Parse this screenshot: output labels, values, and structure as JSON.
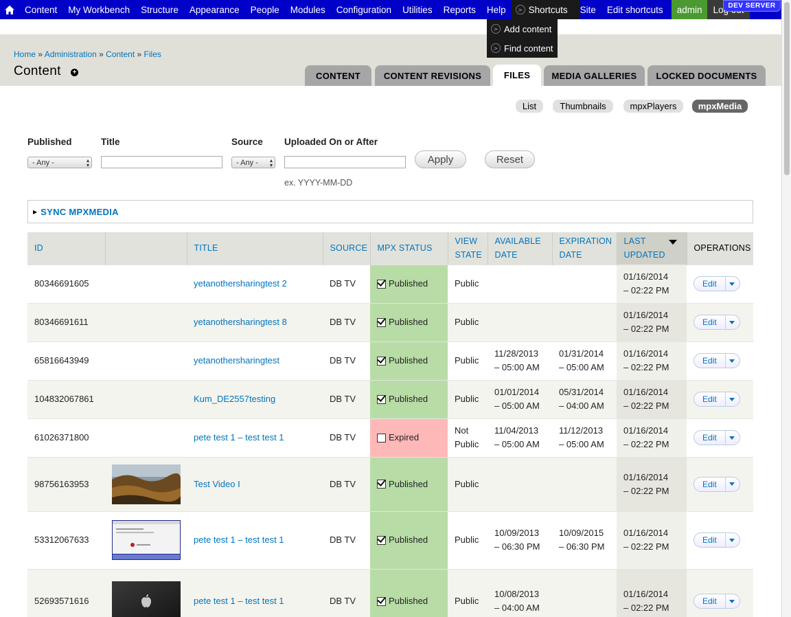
{
  "toolbar": {
    "items": [
      "Content",
      "My Workbench",
      "Structure",
      "Appearance",
      "People",
      "Modules",
      "Configuration",
      "Utilities",
      "Reports",
      "Help"
    ],
    "shortcuts_label": "Shortcuts",
    "site_label": "Site",
    "edit_shortcuts_label": "Edit shortcuts",
    "user_label": "admin",
    "logout_label": "Log out",
    "dev_badge": "DEV SERVER"
  },
  "shortcuts_menu": {
    "items": [
      "Add content",
      "Find content"
    ]
  },
  "breadcrumb": {
    "home": "Home",
    "administration": "Administration",
    "content": "Content",
    "files": "Files",
    "separator": "»"
  },
  "page": {
    "title": "Content",
    "add_shortcut_symbol": "+"
  },
  "tabs": [
    "CONTENT",
    "CONTENT REVISIONS",
    "FILES",
    "MEDIA GALLERIES",
    "LOCKED DOCUMENTS"
  ],
  "active_tab": "FILES",
  "secondary_tabs": [
    "List",
    "Thumbnails",
    "mpxPlayers",
    "mpxMedia"
  ],
  "active_secondary_tab": "mpxMedia",
  "filters": {
    "published_label": "Published",
    "published_value": "- Any -",
    "title_label": "Title",
    "title_value": "",
    "source_label": "Source",
    "source_value": "- Any -",
    "uploaded_label": "Uploaded On or After",
    "uploaded_value": "",
    "uploaded_hint": "ex. YYYY-MM-DD",
    "apply_label": "Apply",
    "reset_label": "Reset"
  },
  "sync_fieldset": {
    "label": "SYNC MPXMEDIA"
  },
  "table": {
    "headers": {
      "id": "ID",
      "title": "TITLE",
      "source": "SOURCE",
      "mpx_status": "MPX STATUS",
      "view_state_1": "VIEW",
      "view_state_2": "STATE",
      "available_1": "AVAILABLE",
      "available_2": "DATE",
      "expiration_1": "EXPIRATION",
      "expiration_2": "DATE",
      "last_updated_1": "LAST",
      "last_updated_2": "UPDATED",
      "operations": "OPERATIONS"
    },
    "sorted_column": "LAST UPDATED",
    "sort_direction": "descending",
    "edit_label": "Edit",
    "colors": {
      "published_bg": "#b8dca6",
      "expired_bg": "#ffb8b8"
    },
    "rows": [
      {
        "id": "80346691605",
        "thumbnail": "none",
        "title": "yetanothersharingtest 2",
        "source": "DB TV",
        "status": "Published",
        "checked": true,
        "view_state_1": "Public",
        "view_state_2": "",
        "avail_1": "",
        "avail_2": "",
        "exp_1": "",
        "exp_2": "",
        "updated_1": "01/16/2014",
        "updated_2": "– 02:22 PM"
      },
      {
        "id": "80346691611",
        "thumbnail": "none",
        "title": "yetanothersharingtest 8",
        "source": "DB TV",
        "status": "Published",
        "checked": true,
        "view_state_1": "Public",
        "view_state_2": "",
        "avail_1": "",
        "avail_2": "",
        "exp_1": "",
        "exp_2": "",
        "updated_1": "01/16/2014",
        "updated_2": "– 02:22 PM"
      },
      {
        "id": "65816643949",
        "thumbnail": "none",
        "title": "yetanothersharingtest",
        "source": "DB TV",
        "status": "Published",
        "checked": true,
        "view_state_1": "Public",
        "view_state_2": "",
        "avail_1": "11/28/2013",
        "avail_2": "– 05:00 AM",
        "exp_1": "01/31/2014",
        "exp_2": "– 05:00 AM",
        "updated_1": "01/16/2014",
        "updated_2": "– 02:22 PM"
      },
      {
        "id": "104832067861",
        "thumbnail": "none",
        "title": "Kum_DE2557testing",
        "source": "DB TV",
        "status": "Published",
        "checked": true,
        "view_state_1": "Public",
        "view_state_2": "",
        "avail_1": "01/01/2014",
        "avail_2": "– 05:00 AM",
        "exp_1": "05/31/2014",
        "exp_2": "– 04:00 AM",
        "updated_1": "01/16/2014",
        "updated_2": "– 02:22 PM"
      },
      {
        "id": "61026371800",
        "thumbnail": "none",
        "title": "pete test 1 – test test 1",
        "source": "DB TV",
        "status": "Expired",
        "checked": false,
        "view_state_1": "Not",
        "view_state_2": "Public",
        "avail_1": "11/04/2013",
        "avail_2": "– 05:00 AM",
        "exp_1": "11/12/2013",
        "exp_2": "– 05:00 AM",
        "updated_1": "01/16/2014",
        "updated_2": "– 02:22 PM"
      },
      {
        "id": "98756163953",
        "thumbnail": "rocky-shore",
        "title": "Test Video I",
        "source": "DB TV",
        "status": "Published",
        "checked": true,
        "view_state_1": "Public",
        "view_state_2": "",
        "avail_1": "",
        "avail_2": "",
        "exp_1": "",
        "exp_2": "",
        "updated_1": "01/16/2014",
        "updated_2": "– 02:22 PM"
      },
      {
        "id": "53312067633",
        "thumbnail": "screenshot",
        "title": "pete test 1 – test test 1",
        "source": "DB TV",
        "status": "Published",
        "checked": true,
        "view_state_1": "Public",
        "view_state_2": "",
        "avail_1": "10/09/2013",
        "avail_2": "– 06:30 PM",
        "exp_1": "10/09/2015",
        "exp_2": "– 06:30 PM",
        "updated_1": "01/16/2014",
        "updated_2": "– 02:22 PM"
      },
      {
        "id": "52693571616",
        "thumbnail": "apple-logo",
        "title": "pete test 1 – test test 1",
        "source": "DB TV",
        "status": "Published",
        "checked": true,
        "view_state_1": "Public",
        "view_state_2": "",
        "avail_1": "10/08/2013",
        "avail_2": "– 04:00 AM",
        "exp_1": "",
        "exp_2": "",
        "updated_1": "01/16/2014",
        "updated_2": "– 02:22 PM"
      }
    ]
  }
}
